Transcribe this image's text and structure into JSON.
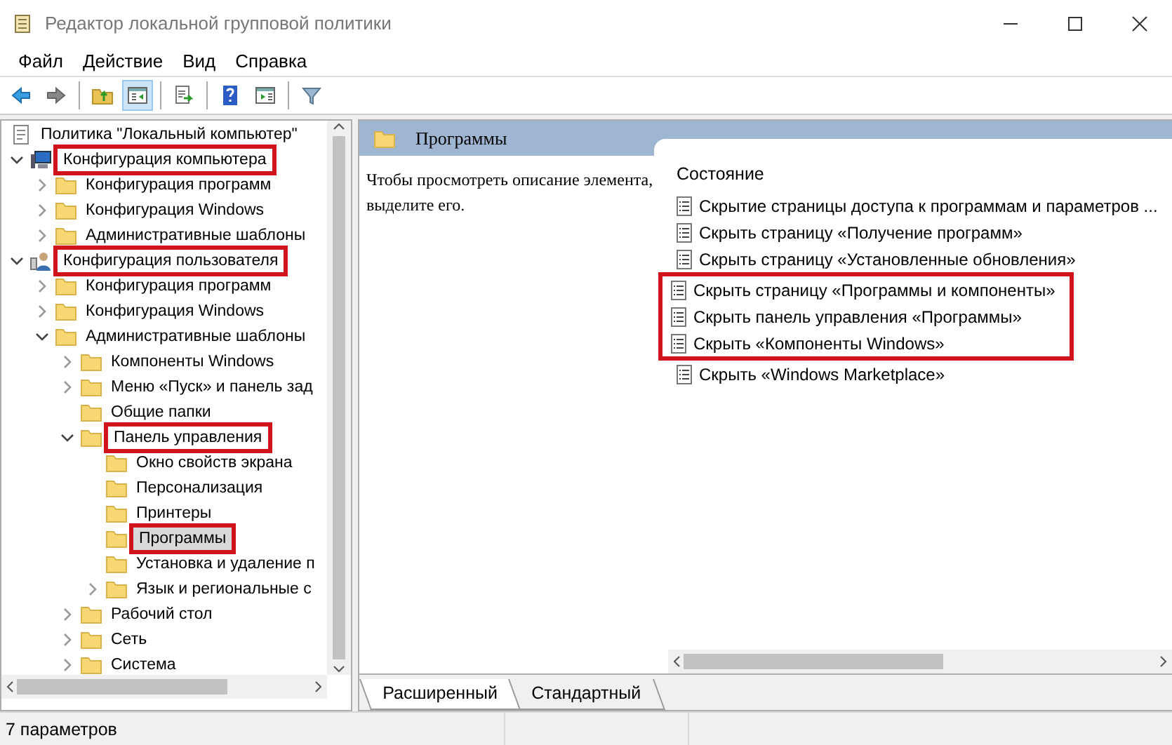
{
  "window": {
    "title": "Редактор локальной групповой политики"
  },
  "menu": [
    "Файл",
    "Действие",
    "Вид",
    "Справка"
  ],
  "toolbar": [
    {
      "kind": "back",
      "pressed": false
    },
    {
      "kind": "forward",
      "pressed": false
    },
    {
      "kind": "sep"
    },
    {
      "kind": "up",
      "pressed": false
    },
    {
      "kind": "tree",
      "pressed": true
    },
    {
      "kind": "sep"
    },
    {
      "kind": "export",
      "pressed": false
    },
    {
      "kind": "sep"
    },
    {
      "kind": "help",
      "pressed": false
    },
    {
      "kind": "pane",
      "pressed": false
    },
    {
      "kind": "sep"
    },
    {
      "kind": "filter",
      "pressed": false
    }
  ],
  "tree": {
    "root": {
      "label": "Политика \"Локальный компьютер\"",
      "kind": "policy"
    },
    "items": [
      {
        "label": "Конфигурация компьютера",
        "kind": "computer",
        "expanded": true,
        "highlighted": true,
        "selected": false,
        "children": [
          {
            "label": "Конфигурация программ",
            "kind": "folder",
            "expanded": false,
            "highlighted": false,
            "selected": false
          },
          {
            "label": "Конфигурация Windows",
            "kind": "folder",
            "expanded": false,
            "highlighted": false,
            "selected": false
          },
          {
            "label": "Административные шаблоны",
            "kind": "folder",
            "expanded": false,
            "highlighted": false,
            "selected": false
          }
        ]
      },
      {
        "label": "Конфигурация пользователя",
        "kind": "user",
        "expanded": true,
        "highlighted": true,
        "selected": false,
        "children": [
          {
            "label": "Конфигурация программ",
            "kind": "folder",
            "expanded": false,
            "highlighted": false,
            "selected": false
          },
          {
            "label": "Конфигурация Windows",
            "kind": "folder",
            "expanded": false,
            "highlighted": false,
            "selected": false
          },
          {
            "label": "Административные шаблоны",
            "kind": "folder",
            "expanded": true,
            "highlighted": false,
            "selected": false,
            "children": [
              {
                "label": "Компоненты Windows",
                "kind": "folder",
                "expanded": false,
                "highlighted": false,
                "selected": false
              },
              {
                "label": "Меню «Пуск» и панель зад",
                "kind": "folder",
                "expanded": false,
                "highlighted": false,
                "selected": false
              },
              {
                "label": "Общие папки",
                "kind": "folder",
                "highlighted": false,
                "selected": false
              },
              {
                "label": "Панель управления",
                "kind": "folder",
                "expanded": true,
                "highlighted": true,
                "selected": false,
                "children": [
                  {
                    "label": "Окно свойств экрана",
                    "kind": "folder",
                    "highlighted": false,
                    "selected": false
                  },
                  {
                    "label": "Персонализация",
                    "kind": "folder",
                    "highlighted": false,
                    "selected": false
                  },
                  {
                    "label": "Принтеры",
                    "kind": "folder",
                    "highlighted": false,
                    "selected": false
                  },
                  {
                    "label": "Программы",
                    "kind": "folder",
                    "highlighted": true,
                    "selected": true
                  },
                  {
                    "label": "Установка и удаление п",
                    "kind": "folder",
                    "highlighted": false,
                    "selected": false
                  },
                  {
                    "label": "Язык и региональные с",
                    "kind": "folder",
                    "expanded": false,
                    "highlighted": false,
                    "selected": false
                  }
                ]
              },
              {
                "label": "Рабочий стол",
                "kind": "folder",
                "expanded": false,
                "highlighted": false,
                "selected": false
              },
              {
                "label": "Сеть",
                "kind": "folder",
                "expanded": false,
                "highlighted": false,
                "selected": false
              },
              {
                "label": "Система",
                "kind": "folder",
                "expanded": false,
                "highlighted": false,
                "selected": false
              }
            ]
          }
        ]
      }
    ]
  },
  "details": {
    "title": "Программы",
    "description": "Чтобы просмотреть описание элемента, выделите его.",
    "column": "Состояние",
    "settings": [
      {
        "label": "Скрытие страницы доступа к программам и параметров ...",
        "highlighted": false
      },
      {
        "label": "Скрыть страницу «Получение программ»",
        "highlighted": false
      },
      {
        "label": "Скрыть страницу «Установленные обновления»",
        "highlighted": false
      },
      {
        "label": "Скрыть страницу «Программы и компоненты»",
        "highlighted": true
      },
      {
        "label": "Скрыть панель управления «Программы»",
        "highlighted": true
      },
      {
        "label": "Скрыть «Компоненты Windows»",
        "highlighted": true
      },
      {
        "label": "Скрыть «Windows Marketplace»",
        "highlighted": false
      }
    ],
    "tabs": [
      {
        "label": "Расширенный",
        "selected": true
      },
      {
        "label": "Стандартный",
        "selected": false
      }
    ]
  },
  "status_bar": "7 параметров"
}
